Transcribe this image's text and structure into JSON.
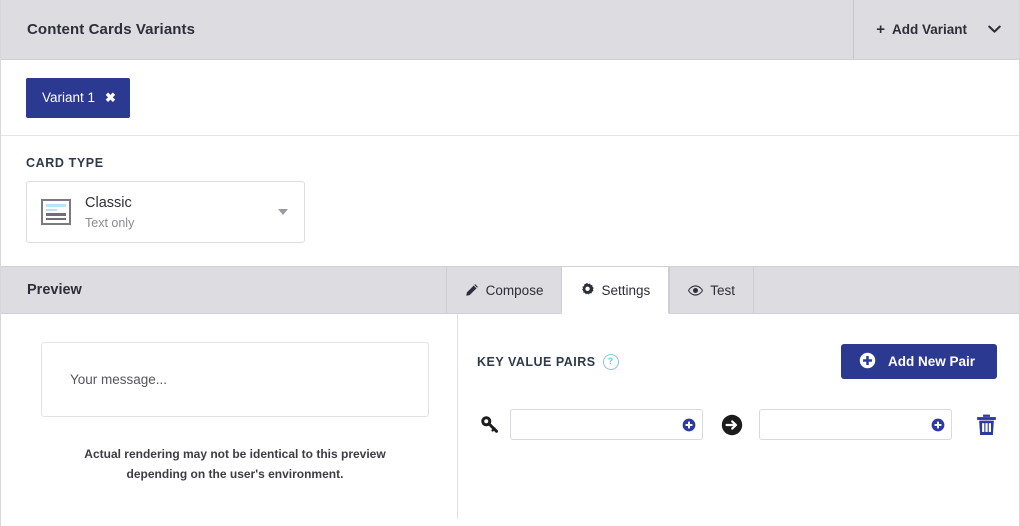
{
  "header": {
    "title": "Content Cards Variants",
    "add_variant_label": "Add Variant",
    "add_variant_plus": "+",
    "add_variant_chevron_icon": "chevron-down-icon"
  },
  "variants": {
    "chips": [
      {
        "label": "Variant 1",
        "close_glyph": "✖"
      }
    ]
  },
  "card_type": {
    "section_label": "CARD TYPE",
    "selected": {
      "name": "Classic",
      "subtitle": "Text only",
      "thumb_icon": "classic-card-icon"
    },
    "caret_icon": "caret-down-icon"
  },
  "preview_bar": {
    "title": "Preview",
    "tabs": [
      {
        "label": "Compose",
        "icon": "pencil-icon",
        "active": false
      },
      {
        "label": "Settings",
        "icon": "gear-icon",
        "active": true
      },
      {
        "label": "Test",
        "icon": "eye-icon",
        "active": false
      }
    ]
  },
  "preview": {
    "message_placeholder": "Your message...",
    "disclaimer": "Actual rendering may not be identical to this preview depending on the user's environment."
  },
  "settings": {
    "kvp_label": "KEY VALUE PAIRS",
    "help_glyph": "?",
    "add_pair_label": "Add New Pair",
    "add_pair_icon": "plus-circle-icon",
    "pairs": [
      {
        "key_icon": "key-icon",
        "key_value": "",
        "key_placeholder": "",
        "arrow_icon": "arrow-right-circle-icon",
        "value_value": "",
        "value_placeholder": "",
        "delete_icon": "trash-icon"
      }
    ]
  },
  "colors": {
    "brand_navy": "#2b3990",
    "header_gray": "#dcdce1",
    "help_teal": "#7fc9dd",
    "text_dark": "#2e2e38"
  }
}
